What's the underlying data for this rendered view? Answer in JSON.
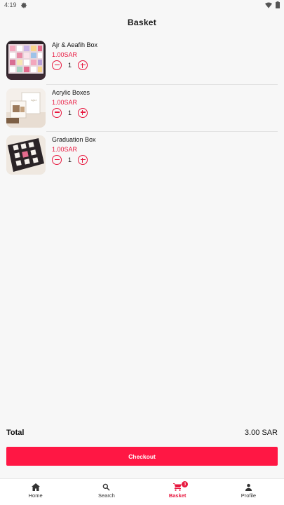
{
  "status_bar": {
    "time": "4:19"
  },
  "app_bar": {
    "title": "Basket"
  },
  "items": [
    {
      "name": "Ajr & Aeafih Box",
      "price": "1.00SAR",
      "quantity": "1"
    },
    {
      "name": "Acrylic Boxes",
      "price": "1.00SAR",
      "quantity": "1"
    },
    {
      "name": "Graduation Box",
      "price": "1.00SAR",
      "quantity": "1"
    }
  ],
  "summary": {
    "total_label": "Total",
    "total_value": "3.00 SAR"
  },
  "checkout_label": "Checkout",
  "nav": {
    "home": "Home",
    "search": "Search",
    "basket": "Basket",
    "basket_badge": "3",
    "profile": "Profile"
  },
  "colors": {
    "accent": "#e8183f",
    "button": "#ff1744",
    "background": "#f7f7f7"
  },
  "icons": [
    "settings-icon",
    "wifi-icon",
    "battery-icon",
    "minus-circle-icon",
    "plus-circle-icon",
    "home-icon",
    "search-icon",
    "cart-icon",
    "person-icon"
  ]
}
